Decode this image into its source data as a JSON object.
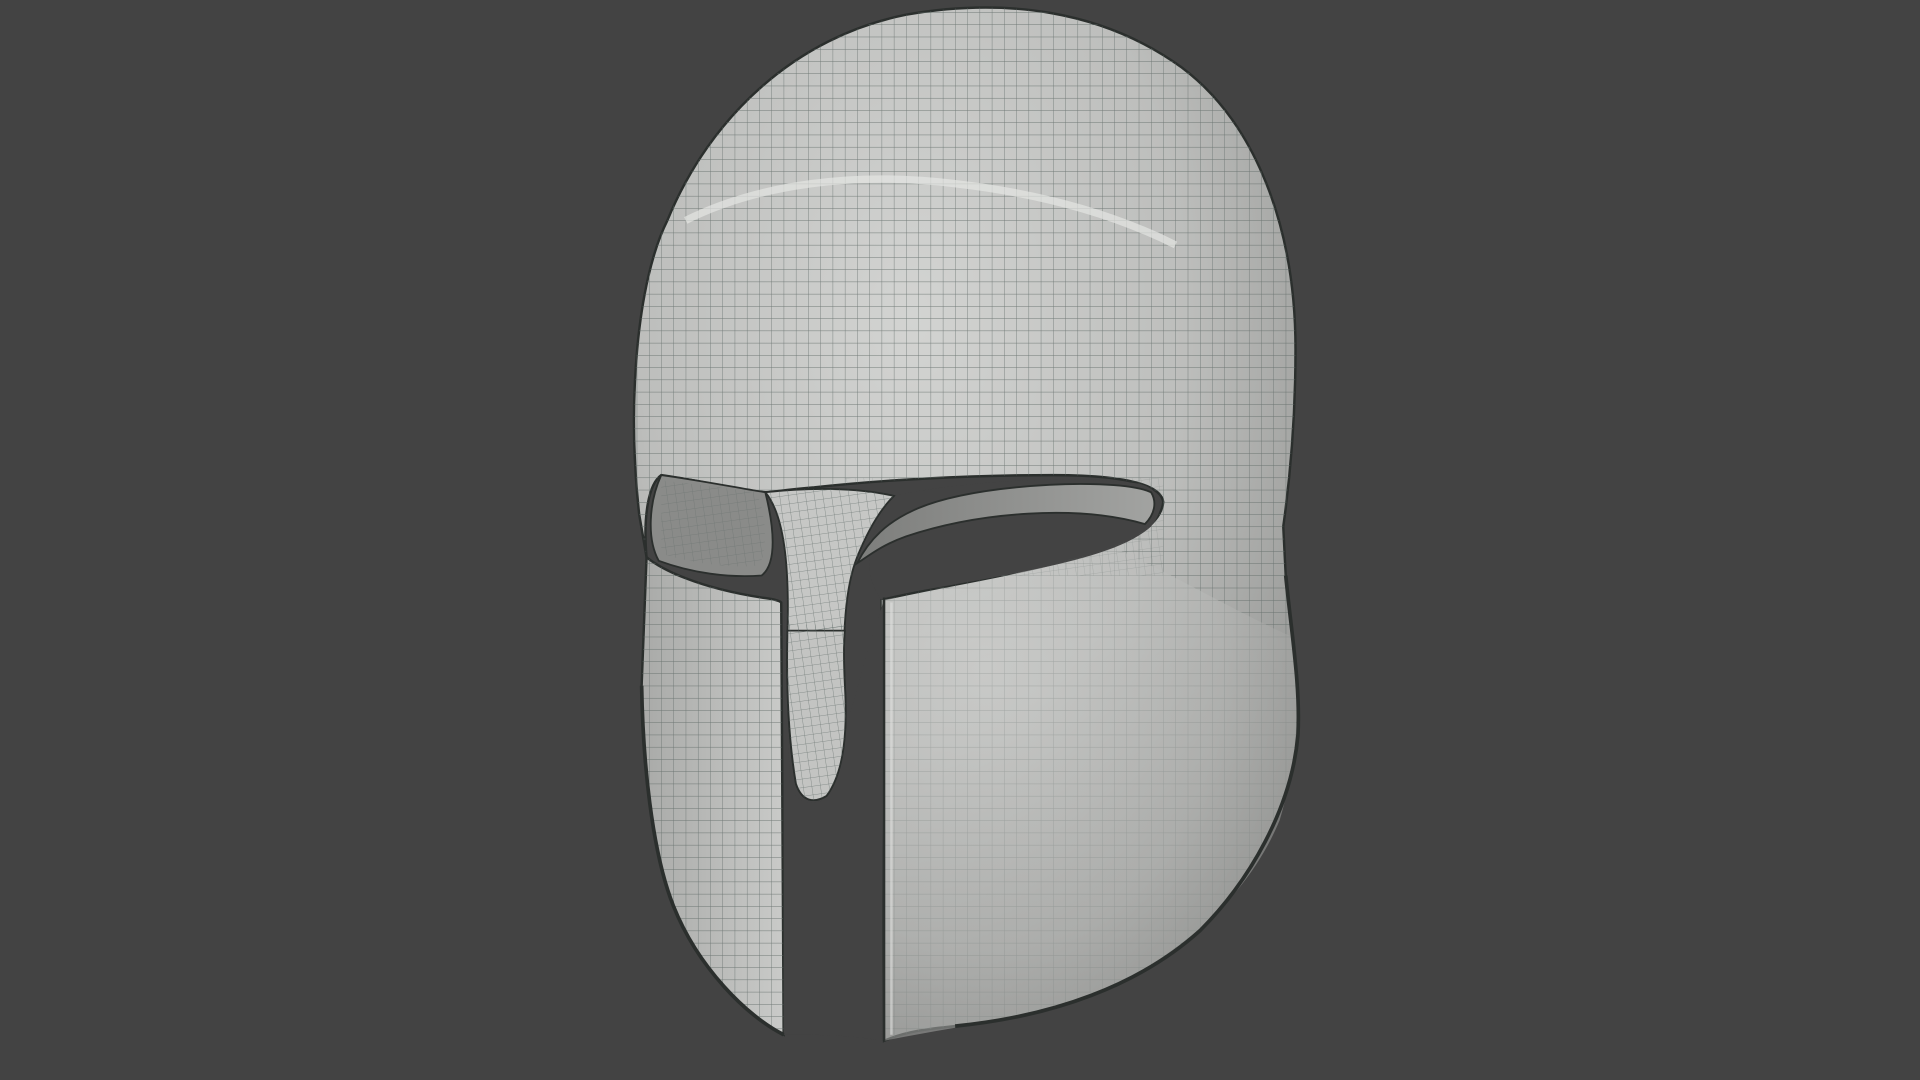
{
  "viewport": {
    "background_color": "#434343"
  },
  "model": {
    "object": "corinthian-helmet",
    "display_mode": "wireframe-on-shaded",
    "surface_color": "#b9b9b9",
    "wire_color": "#5f6a66",
    "edge_color": "#2b2f2d"
  }
}
